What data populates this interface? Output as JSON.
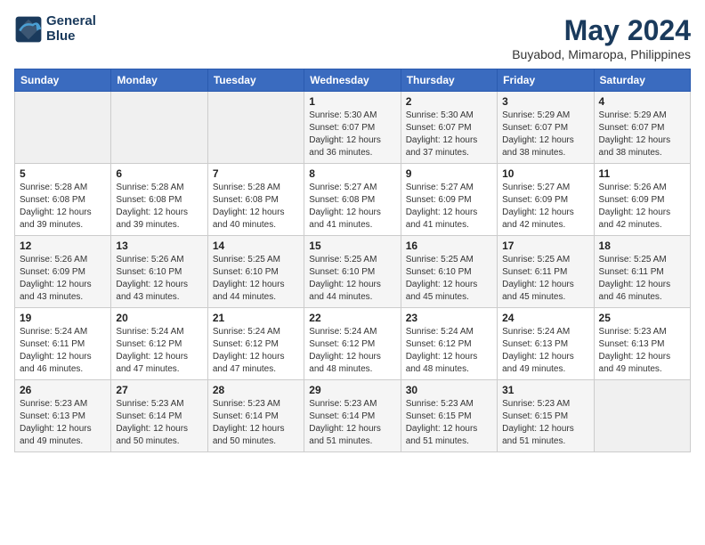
{
  "header": {
    "logo_line1": "General",
    "logo_line2": "Blue",
    "month_title": "May 2024",
    "location": "Buyabod, Mimaropa, Philippines"
  },
  "days_of_week": [
    "Sunday",
    "Monday",
    "Tuesday",
    "Wednesday",
    "Thursday",
    "Friday",
    "Saturday"
  ],
  "weeks": [
    [
      {
        "num": "",
        "info": ""
      },
      {
        "num": "",
        "info": ""
      },
      {
        "num": "",
        "info": ""
      },
      {
        "num": "1",
        "info": "Sunrise: 5:30 AM\nSunset: 6:07 PM\nDaylight: 12 hours\nand 36 minutes."
      },
      {
        "num": "2",
        "info": "Sunrise: 5:30 AM\nSunset: 6:07 PM\nDaylight: 12 hours\nand 37 minutes."
      },
      {
        "num": "3",
        "info": "Sunrise: 5:29 AM\nSunset: 6:07 PM\nDaylight: 12 hours\nand 38 minutes."
      },
      {
        "num": "4",
        "info": "Sunrise: 5:29 AM\nSunset: 6:07 PM\nDaylight: 12 hours\nand 38 minutes."
      }
    ],
    [
      {
        "num": "5",
        "info": "Sunrise: 5:28 AM\nSunset: 6:08 PM\nDaylight: 12 hours\nand 39 minutes."
      },
      {
        "num": "6",
        "info": "Sunrise: 5:28 AM\nSunset: 6:08 PM\nDaylight: 12 hours\nand 39 minutes."
      },
      {
        "num": "7",
        "info": "Sunrise: 5:28 AM\nSunset: 6:08 PM\nDaylight: 12 hours\nand 40 minutes."
      },
      {
        "num": "8",
        "info": "Sunrise: 5:27 AM\nSunset: 6:08 PM\nDaylight: 12 hours\nand 41 minutes."
      },
      {
        "num": "9",
        "info": "Sunrise: 5:27 AM\nSunset: 6:09 PM\nDaylight: 12 hours\nand 41 minutes."
      },
      {
        "num": "10",
        "info": "Sunrise: 5:27 AM\nSunset: 6:09 PM\nDaylight: 12 hours\nand 42 minutes."
      },
      {
        "num": "11",
        "info": "Sunrise: 5:26 AM\nSunset: 6:09 PM\nDaylight: 12 hours\nand 42 minutes."
      }
    ],
    [
      {
        "num": "12",
        "info": "Sunrise: 5:26 AM\nSunset: 6:09 PM\nDaylight: 12 hours\nand 43 minutes."
      },
      {
        "num": "13",
        "info": "Sunrise: 5:26 AM\nSunset: 6:10 PM\nDaylight: 12 hours\nand 43 minutes."
      },
      {
        "num": "14",
        "info": "Sunrise: 5:25 AM\nSunset: 6:10 PM\nDaylight: 12 hours\nand 44 minutes."
      },
      {
        "num": "15",
        "info": "Sunrise: 5:25 AM\nSunset: 6:10 PM\nDaylight: 12 hours\nand 44 minutes."
      },
      {
        "num": "16",
        "info": "Sunrise: 5:25 AM\nSunset: 6:10 PM\nDaylight: 12 hours\nand 45 minutes."
      },
      {
        "num": "17",
        "info": "Sunrise: 5:25 AM\nSunset: 6:11 PM\nDaylight: 12 hours\nand 45 minutes."
      },
      {
        "num": "18",
        "info": "Sunrise: 5:25 AM\nSunset: 6:11 PM\nDaylight: 12 hours\nand 46 minutes."
      }
    ],
    [
      {
        "num": "19",
        "info": "Sunrise: 5:24 AM\nSunset: 6:11 PM\nDaylight: 12 hours\nand 46 minutes."
      },
      {
        "num": "20",
        "info": "Sunrise: 5:24 AM\nSunset: 6:12 PM\nDaylight: 12 hours\nand 47 minutes."
      },
      {
        "num": "21",
        "info": "Sunrise: 5:24 AM\nSunset: 6:12 PM\nDaylight: 12 hours\nand 47 minutes."
      },
      {
        "num": "22",
        "info": "Sunrise: 5:24 AM\nSunset: 6:12 PM\nDaylight: 12 hours\nand 48 minutes."
      },
      {
        "num": "23",
        "info": "Sunrise: 5:24 AM\nSunset: 6:12 PM\nDaylight: 12 hours\nand 48 minutes."
      },
      {
        "num": "24",
        "info": "Sunrise: 5:24 AM\nSunset: 6:13 PM\nDaylight: 12 hours\nand 49 minutes."
      },
      {
        "num": "25",
        "info": "Sunrise: 5:23 AM\nSunset: 6:13 PM\nDaylight: 12 hours\nand 49 minutes."
      }
    ],
    [
      {
        "num": "26",
        "info": "Sunrise: 5:23 AM\nSunset: 6:13 PM\nDaylight: 12 hours\nand 49 minutes."
      },
      {
        "num": "27",
        "info": "Sunrise: 5:23 AM\nSunset: 6:14 PM\nDaylight: 12 hours\nand 50 minutes."
      },
      {
        "num": "28",
        "info": "Sunrise: 5:23 AM\nSunset: 6:14 PM\nDaylight: 12 hours\nand 50 minutes."
      },
      {
        "num": "29",
        "info": "Sunrise: 5:23 AM\nSunset: 6:14 PM\nDaylight: 12 hours\nand 51 minutes."
      },
      {
        "num": "30",
        "info": "Sunrise: 5:23 AM\nSunset: 6:15 PM\nDaylight: 12 hours\nand 51 minutes."
      },
      {
        "num": "31",
        "info": "Sunrise: 5:23 AM\nSunset: 6:15 PM\nDaylight: 12 hours\nand 51 minutes."
      },
      {
        "num": "",
        "info": ""
      }
    ]
  ]
}
